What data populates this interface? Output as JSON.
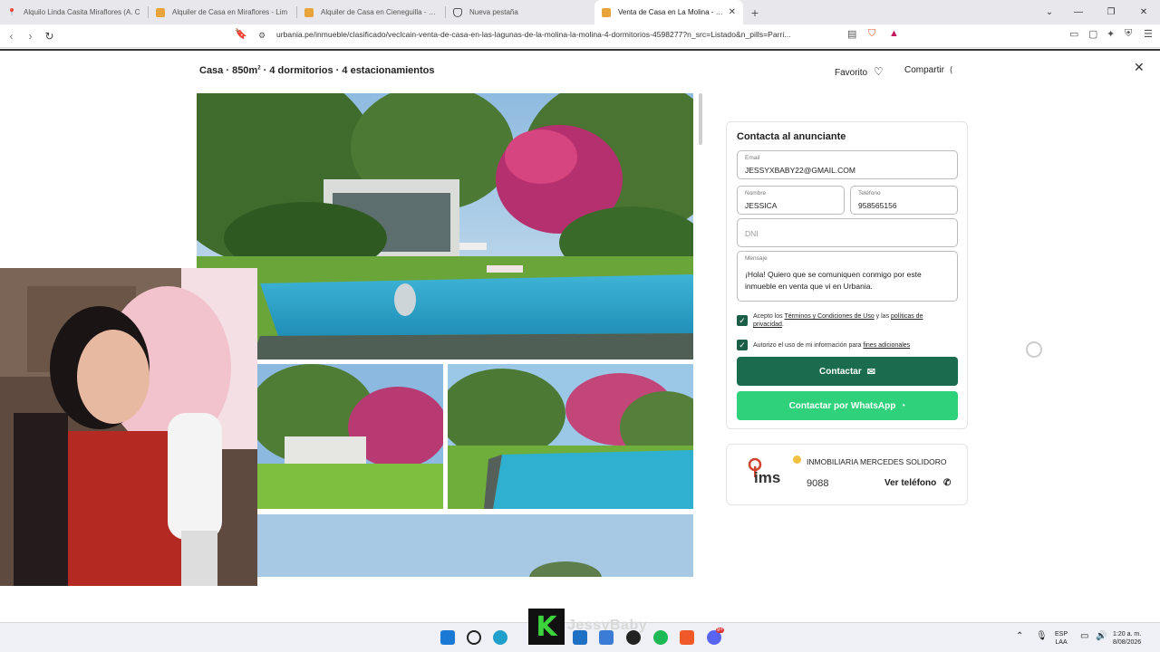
{
  "tabs": [
    {
      "title": "Alquilo Linda Casita Miraflores (A. C",
      "favicon_color": "#e0443b"
    },
    {
      "title": "Alquiler de Casa en Miraflores - Lim",
      "favicon_color": "#e8a43a"
    },
    {
      "title": "Alquiler de Casa en Cieneguilla - Lim",
      "favicon_color": "#e8a43a"
    },
    {
      "title": "Nueva pestaña",
      "favicon_color": "#555555"
    },
    {
      "title": "Venta de Casa en La Molina - Lim",
      "favicon_color": "#e8a43a",
      "active": true
    }
  ],
  "new_tab_icon": "+",
  "address": {
    "url": "urbania.pe/inmueble/clasificado/veclcain-venta-de-casa-en-las-lagunas-de-la-molina-la-molina-4-dormitorios-4598277?n_src=Listado&n_pills=Parri..."
  },
  "listing": {
    "headline_prefix": "Casa · 850m",
    "headline_sup": "2",
    "headline_suffix": " · 4 dormitorios · 4 estacionamientos",
    "favorite_label": "Favorito",
    "share_label": "Compartir"
  },
  "contact": {
    "title": "Contacta al anunciante",
    "email_label": "Email",
    "email_value": "JESSYXBABY22@GMAIL.COM",
    "name_label": "Nombre",
    "name_value": "JESSICA",
    "phone_label": "Teléfono",
    "phone_value": "958565156",
    "dni_placeholder": "DNI",
    "message_label": "Mensaje",
    "message_value": "¡Hola! Quiero que se comuniquen conmigo por este inmueble en venta que vi en Urbania.",
    "terms_prefix": "Acepto los ",
    "terms_link": "Términos y Condiciones de Uso",
    "terms_mid": " y las ",
    "privacy_link": "políticas de privacidad",
    "terms_end": ".",
    "consent_prefix": "Autorizo el uso de mi información para ",
    "consent_link": "fines adicionales",
    "contact_button": "Contactar",
    "whatsapp_button": "Contactar por WhatsApp"
  },
  "agent": {
    "name": "INMOBILIARIA MERCEDES SOLIDORO",
    "logo_text": "ims",
    "phone_partial": "9088",
    "see_phone": "Ver teléfono"
  },
  "overlay": {
    "stream_name": "JessyBaby",
    "logo_letter": "K"
  },
  "tray": {
    "lang_top": "ESP",
    "lang_bottom": "LAA",
    "time": "1:20 a. m.",
    "date": "8/08/2026",
    "notif_badge": "9+"
  },
  "colors": {
    "primary": "#1b6b4f",
    "whatsapp": "#2fd27a"
  }
}
